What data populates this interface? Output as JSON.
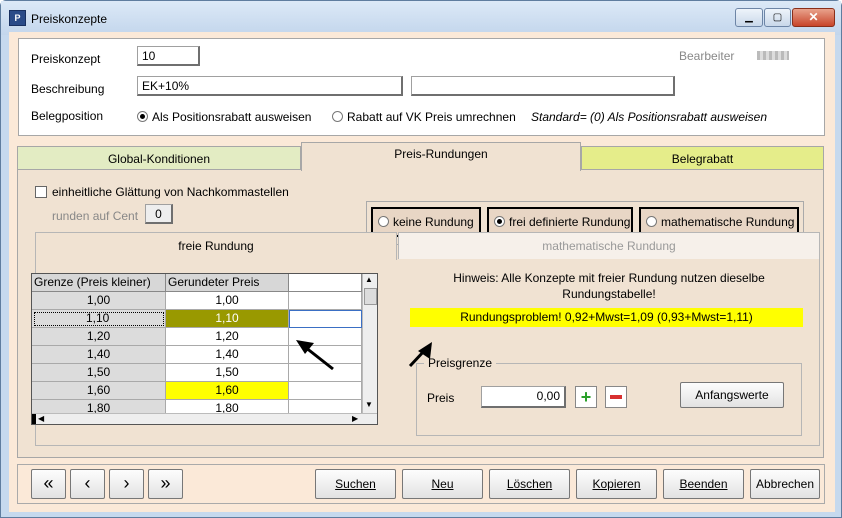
{
  "window": {
    "title": "Preiskonzepte",
    "icon": "app-icon",
    "min": "minimize-icon",
    "max": "maximize-icon",
    "close": "close-icon"
  },
  "header": {
    "preiskonzept_label": "Preiskonzept",
    "preiskonzept_value": "10",
    "bearbeiter_label": "Bearbeiter",
    "beschreibung_label": "Beschreibung",
    "beschreibung_value": "EK+10%",
    "beschreibung_value2": "",
    "belegposition_label": "Belegposition",
    "radio1": "Als Positionsrabatt ausweisen",
    "radio2": "Rabatt auf VK Preis umrechnen",
    "standard_note": "Standard= (0) Als Positionsrabatt ausweisen"
  },
  "tabs": [
    "Global-Konditionen",
    "Preis-Rundungen",
    "Belegrabatt"
  ],
  "rundung": {
    "checkbox_label": "einheitliche Glättung von Nachkommastellen",
    "cent_label": "runden auf Cent",
    "cent_value": "0",
    "options": [
      "keine Rundung",
      "frei definierte Rundung",
      "mathematische Rundung"
    ]
  },
  "subtabs": [
    "freie Rundung",
    "mathematische Rundung"
  ],
  "grid": {
    "columns": [
      "Grenze (Preis kleiner)",
      "Gerundeter Preis"
    ],
    "rows": [
      [
        "1,00",
        "1,00"
      ],
      [
        "1,10",
        "1,10"
      ],
      [
        "1,20",
        "1,20"
      ],
      [
        "1,40",
        "1,40"
      ],
      [
        "1,50",
        "1,50"
      ],
      [
        "1,60",
        "1,60"
      ],
      [
        "1,80",
        "1,80"
      ]
    ]
  },
  "hint": {
    "line1": "Hinweis: Alle Konzepte mit freier Rundung nutzen dieselbe",
    "line2": "Rundungstabelle!",
    "problem": "Rundungsproblem! 0,92+Mwst=1,09 (0,93+Mwst=1,11)"
  },
  "preisgrenze": {
    "legend": "Preisgrenze",
    "preis_label": "Preis",
    "preis_value": "0,00",
    "add_icon": "plus-icon",
    "remove_icon": "minus-icon",
    "anfangswerte": "Anfangswerte"
  },
  "nav": {
    "first": "«",
    "prev": "‹",
    "next": "›",
    "last": "»"
  },
  "buttons": {
    "suchen": "Suchen",
    "neu": "Neu",
    "loeschen": "Löschen",
    "kopieren": "Kopieren",
    "beenden": "Beenden",
    "abbrechen": "Abbrechen"
  },
  "colors": {
    "highlight_olive": "#999900",
    "highlight_yellow": "#ffff00",
    "tab_green": "#e3ecc3",
    "tab_yellow": "#e5ed8a"
  }
}
